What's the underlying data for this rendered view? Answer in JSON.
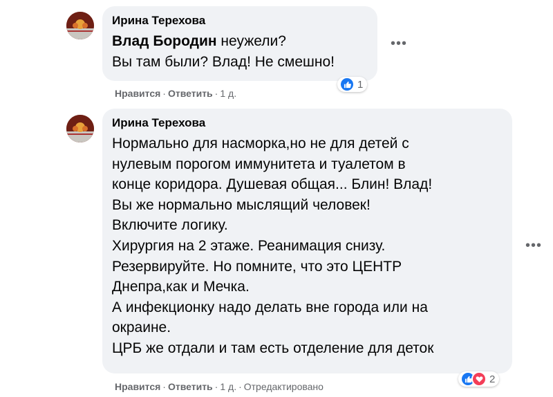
{
  "comments": [
    {
      "author": "Ирина Терехова",
      "mention": "Влад Бородин",
      "text_after_mention": " неужели?",
      "lines_rest": "Вы там были? Влад! Не смешно!",
      "actions": {
        "like": "Нравится",
        "reply": "Ответить",
        "time": "1 д."
      },
      "reaction_count": "1",
      "reaction_icons": [
        "like-icon"
      ]
    },
    {
      "author": "Ирина Терехова",
      "text": "Нормально для насморка,но не для детей с\nнулевым порогом иммунитета и туалетом в\nконце коридора. Душевая общая... Блин! Влад!\nВы же нормально мыслящий человек!\nВключите логику.\nХирургия на 2 этаже. Реанимация снизу.\nРезервируйте. Но помните, что это ЦЕНТР\nДнепра,как и Мечка.\nА инфекционку надо делать вне города или на\nокраине.\nЦРБ же отдали и там есть отделение для деток",
      "actions": {
        "like": "Нравится",
        "reply": "Ответить",
        "time": "1 д.",
        "edited": "Отредактировано"
      },
      "reaction_count": "2",
      "reaction_icons": [
        "like-icon",
        "love-icon"
      ]
    }
  ],
  "more_label": "•••",
  "colors": {
    "bubble": "#f0f2f5",
    "like": "#1877f2",
    "love": "#f33e58",
    "meta": "#65676b"
  }
}
